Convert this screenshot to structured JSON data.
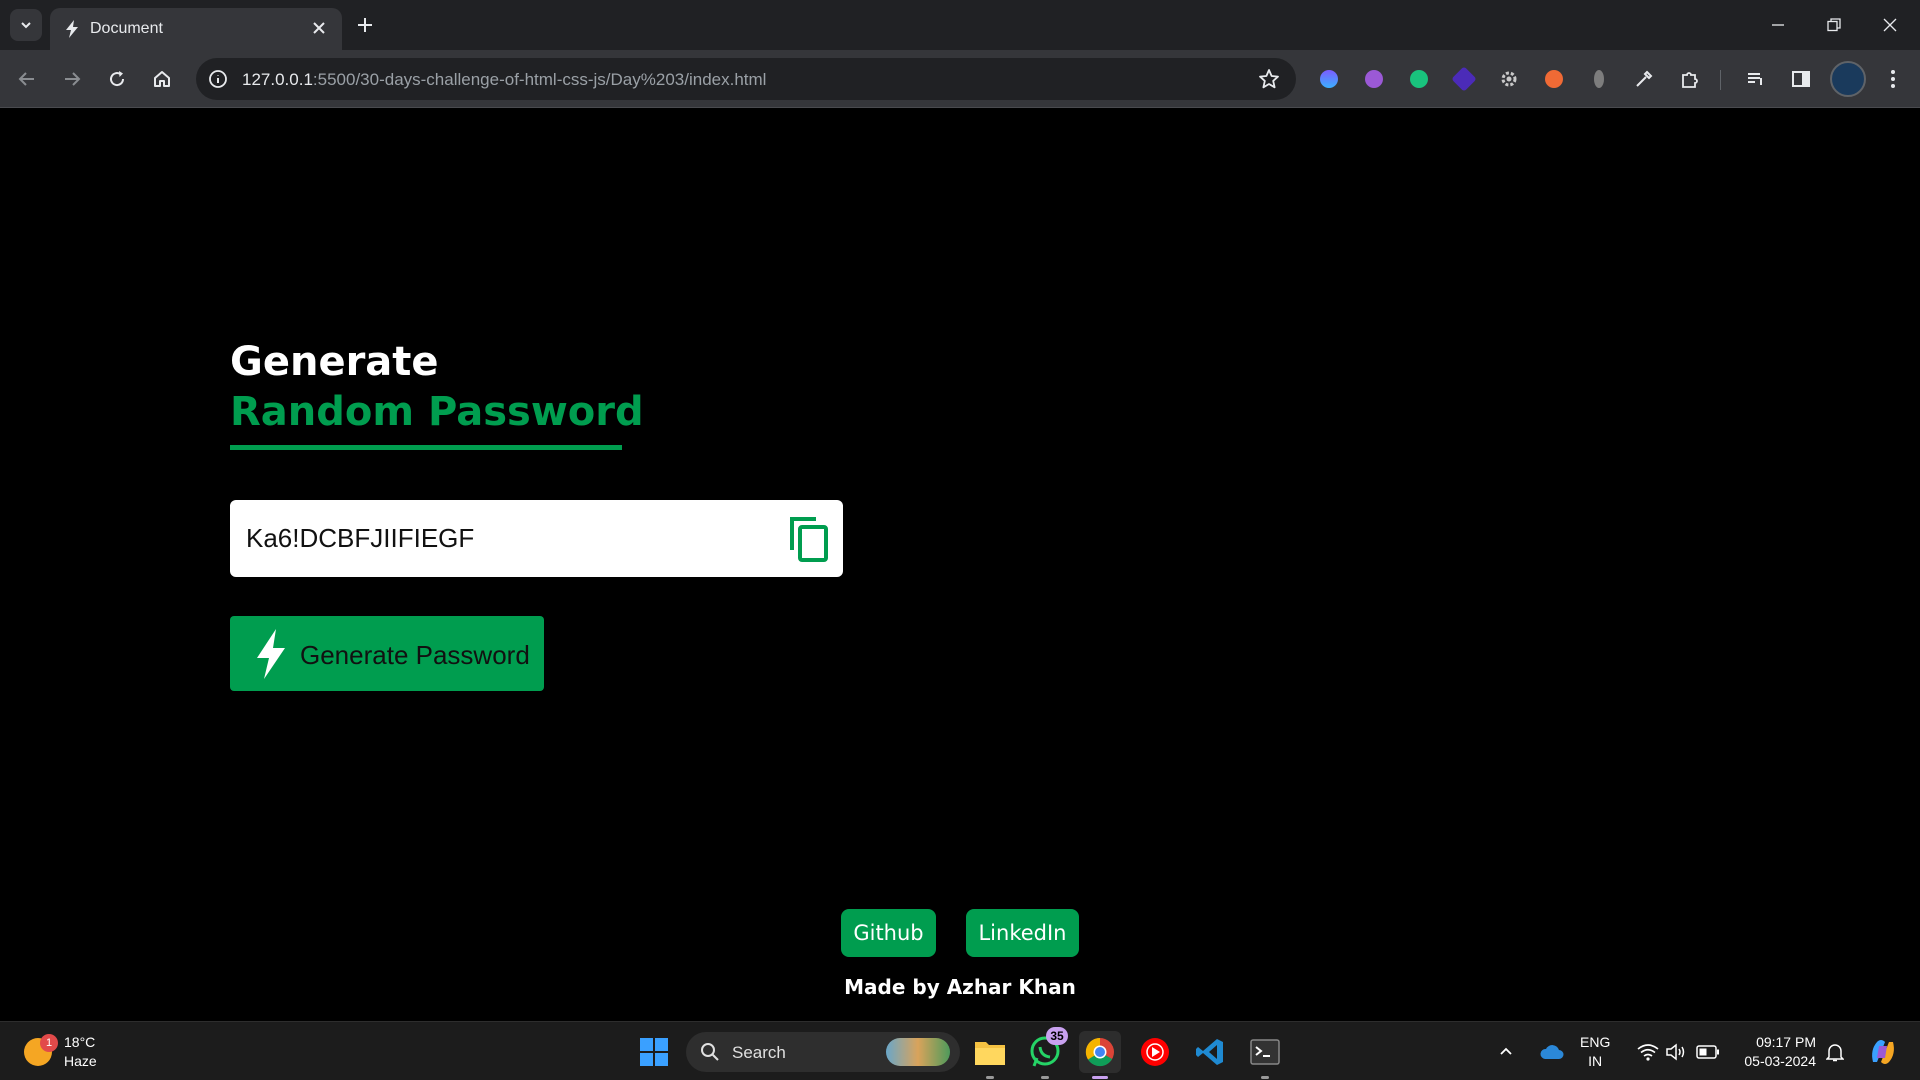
{
  "browser": {
    "tab_title": "Document",
    "url_host": "127.0.0.1",
    "url_rest": ":5500/30-days-challenge-of-html-css-js/Day%203/index.html"
  },
  "page": {
    "heading_line1": "Generate",
    "heading_line2": "Random Password",
    "password_value": "Ka6!DCBFJIIFIEGF",
    "generate_button_label": "Generate Password",
    "links": [
      {
        "label": "Github"
      },
      {
        "label": "LinkedIn"
      }
    ],
    "credit": "Made by Azhar Khan",
    "accent_color": "#009d4f"
  },
  "taskbar": {
    "weather_temp": "18°C",
    "weather_condition": "Haze",
    "weather_badge": "1",
    "search_label": "Search",
    "whatsapp_badge": "35",
    "language_line1": "ENG",
    "language_line2": "IN",
    "time": "09:17 PM",
    "date": "05-03-2024"
  }
}
